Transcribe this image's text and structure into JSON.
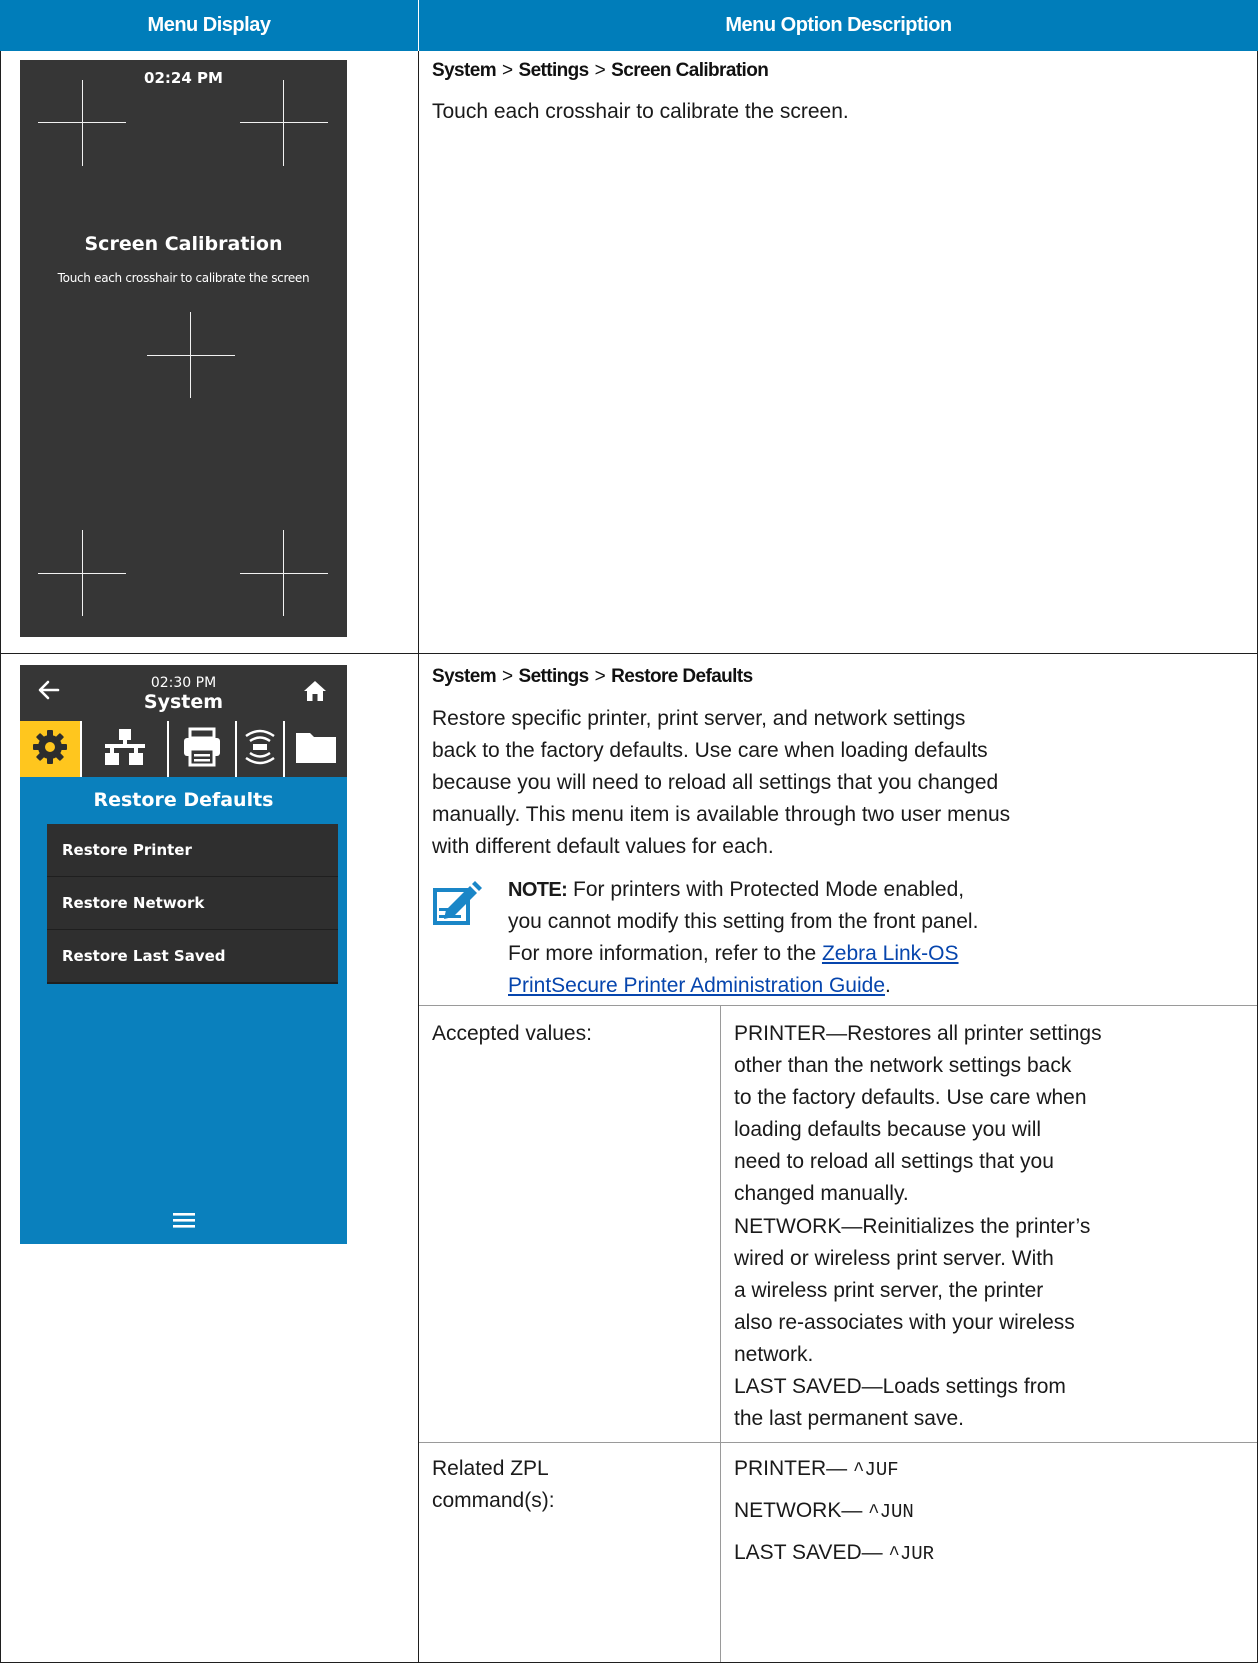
{
  "header": {
    "col1": "Menu Display",
    "col2": "Menu Option Description"
  },
  "screen_calibration": {
    "display": {
      "time": "02:24 PM",
      "title": "Screen Calibration",
      "subtitle": "Touch each crosshair to calibrate the screen"
    },
    "breadcrumb": [
      "System",
      ">",
      "Settings",
      ">",
      "Screen Calibration"
    ],
    "description": "Touch each crosshair to calibrate the screen."
  },
  "restore_defaults": {
    "display": {
      "time": "02:30 PM",
      "header_title": "System",
      "title": "Restore Defaults",
      "items": [
        "Restore Printer",
        "Restore Network",
        "Restore Last Saved"
      ],
      "icons": [
        "back-arrow-icon",
        "home-icon",
        "gear-icon",
        "network-icon",
        "printer-icon",
        "rfid-icon",
        "folder-icon",
        "hamburger-menu-icon"
      ],
      "active_tab_color": "#ffc61e",
      "background_color": "#0a80bd"
    },
    "breadcrumb": [
      "System",
      ">",
      "Settings",
      ">",
      "Restore Defaults"
    ],
    "description": [
      "Restore specific printer, print server, and network settings",
      "back to the factory defaults. Use care when loading defaults",
      "because you will need to reload all settings that you changed",
      "manually. This menu item is available through two user menus",
      "with different default values for each."
    ],
    "note": {
      "label": "NOTE:",
      "line1": " For printers with Protected Mode enabled,",
      "line2": "you cannot modify this setting from the front panel.",
      "line3": "For more information, refer to the ",
      "link_part1": "Zebra Link-OS",
      "link_part2": "PrintSecure Printer Administration Guide",
      "end": "."
    },
    "accepted_label": "Accepted values:",
    "accepted_values": {
      "printer": [
        "PRINTER—Restores all printer settings",
        "other than the network settings back",
        "to the factory defaults. Use care when",
        "loading defaults because you will",
        "need to reload all settings that you",
        "changed manually."
      ],
      "network": [
        "NETWORK—Reinitializes the printer’s",
        "wired or wireless print server. With",
        "a wireless print server, the printer",
        "also re-associates with your wireless",
        "network."
      ],
      "last_saved": [
        "LAST SAVED—Loads settings from",
        "the last permanent save."
      ]
    },
    "zpl_label": [
      "Related ZPL",
      "command(s):"
    ],
    "zpl": [
      {
        "name": "PRINTER— ",
        "cmd": "^JUF"
      },
      {
        "name": "NETWORK— ",
        "cmd": "^JUN"
      },
      {
        "name": "LAST SAVED— ",
        "cmd": "^JUR"
      }
    ]
  }
}
